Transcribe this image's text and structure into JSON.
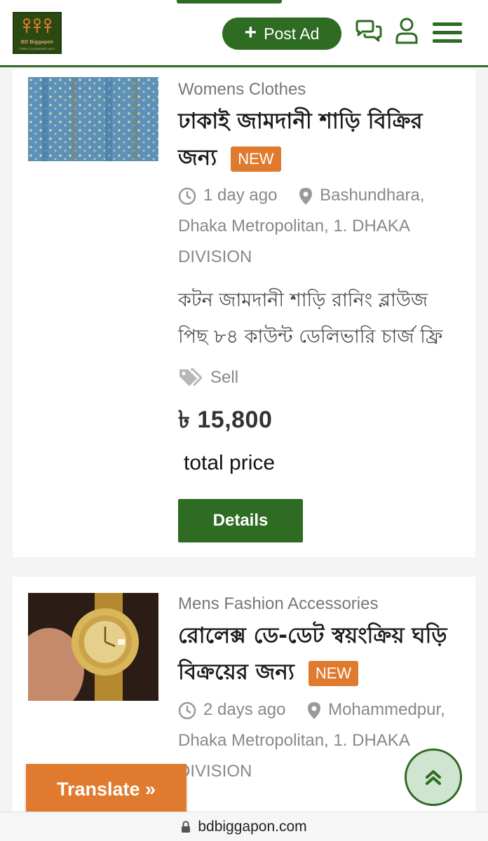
{
  "header": {
    "logo_name": "BD Biggapon",
    "logo_tagline": "FREE CLASSIFIED ADS",
    "post_ad_label": "Post Ad",
    "plus_symbol": "+"
  },
  "listings": [
    {
      "category": "Womens Clothes",
      "title": "ঢাকাই জামদানী শাড়ি বিক্রির জন্য",
      "badge": "NEW",
      "time": "1 day ago",
      "location": "Bashundhara, Dhaka Metropolitan, 1. DHAKA DIVISION",
      "description": "কটন জামদানী শাড়ি রানিং ব্লাউজ পিছ ৮৪ কাউন্ট ডেলিভারি চার্জ ফ্রি",
      "tag": "Sell",
      "price": "৳ 15,800",
      "price_note": "total price",
      "details_label": "Details"
    },
    {
      "category": "Mens Fashion Accessories",
      "title": "রোলেক্স ডে-ডেট স্বয়ংক্রিয় ঘড়ি বিক্রয়ের জন্য",
      "badge": "NEW",
      "time": "2 days ago",
      "location": "Mohammedpur, Dhaka Metropolitan, 1. DHAKA DIVISION"
    }
  ],
  "translate_label": "Translate »",
  "url": "bdbiggapon.com",
  "colors": {
    "brand_green": "#2e6b23",
    "badge_orange": "#e07a2e",
    "translate_orange": "#e07a2e"
  },
  "icons": [
    "plus-icon",
    "chat-icon",
    "user-icon",
    "menu-icon",
    "clock-icon",
    "location-pin-icon",
    "tag-icon",
    "chevron-double-up-icon",
    "lock-icon"
  ]
}
